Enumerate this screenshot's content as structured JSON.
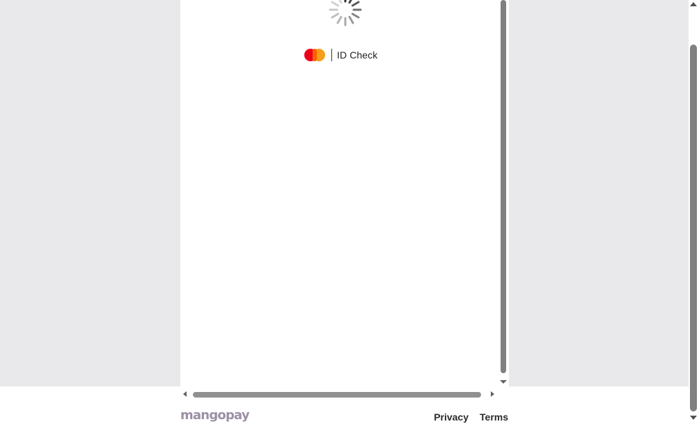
{
  "payment_frame": {
    "loading_icon": "spinner-icon",
    "brand": {
      "icon": "mastercard-logo",
      "label": "ID Check",
      "colors": {
        "red": "#eb001b",
        "yellow": "#f79e1b",
        "overlap": "#ff5f00"
      }
    }
  },
  "footer": {
    "logo_text": "mangopay",
    "links": [
      {
        "label": "Privacy"
      },
      {
        "label": "Terms"
      }
    ]
  },
  "colors": {
    "page_background": "#e9e8eb",
    "logo": "#9b8fa5"
  }
}
